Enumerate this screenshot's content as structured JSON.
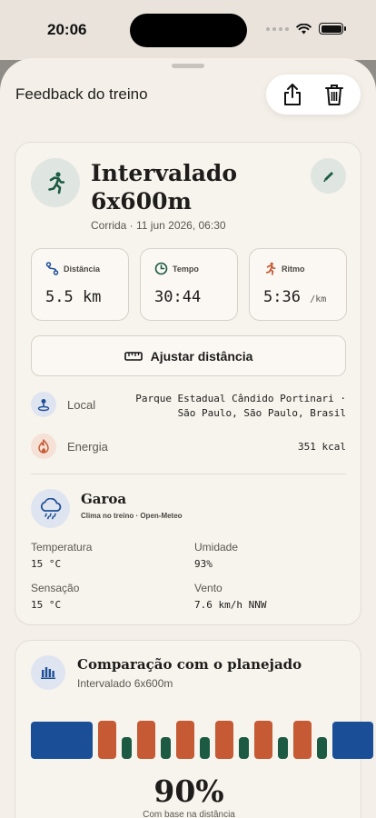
{
  "status": {
    "time": "20:06"
  },
  "sheet": {
    "title": "Feedback do treino"
  },
  "workout": {
    "title": "Intervalado 6x600m",
    "subtitle": "Corrida · 11 jun 2026, 06:30"
  },
  "stats": [
    {
      "label": "Distância",
      "value": "5.5 km",
      "unit": "",
      "icon": "route-icon",
      "color": "#1f4f96"
    },
    {
      "label": "Tempo",
      "value": "30:44",
      "unit": "",
      "icon": "clock-icon",
      "color": "#1c5a44"
    },
    {
      "label": "Ritmo",
      "value": "5:36",
      "unit": "/km",
      "icon": "runner-icon",
      "color": "#c55a34"
    }
  ],
  "adjust_button": {
    "label": "Ajustar distância"
  },
  "location": {
    "label": "Local",
    "value_line1": "Parque Estadual Cândido Portinari ·",
    "value_line2": "São Paulo, São Paulo, Brasil"
  },
  "energy": {
    "label": "Energia",
    "value": "351 kcal"
  },
  "weather": {
    "condition": "Garoa",
    "source": "Clima no treino · Open-Meteo",
    "temperature_label": "Temperatura",
    "temperature": "15 °C",
    "humidity_label": "Umidade",
    "humidity": "93%",
    "feels_label": "Sensação",
    "feels": "15 °C",
    "wind_label": "Vento",
    "wind": "7.6 km/h NNW"
  },
  "comparison": {
    "title": "Comparação com o planejado",
    "subtitle": "Intervalado 6x600m",
    "percent": "90%",
    "note": "Com base na distância",
    "segments": [
      {
        "kind": "warmup",
        "color": "#1a4f98"
      },
      {
        "kind": "interval",
        "color": "#c55a34"
      },
      {
        "kind": "recovery",
        "color": "#1c5a44"
      },
      {
        "kind": "interval",
        "color": "#c55a34"
      },
      {
        "kind": "recovery",
        "color": "#1c5a44"
      },
      {
        "kind": "interval",
        "color": "#c55a34"
      },
      {
        "kind": "recovery",
        "color": "#1c5a44"
      },
      {
        "kind": "interval",
        "color": "#c55a34"
      },
      {
        "kind": "recovery",
        "color": "#1c5a44"
      },
      {
        "kind": "interval",
        "color": "#c55a34"
      },
      {
        "kind": "recovery",
        "color": "#1c5a44"
      },
      {
        "kind": "interval",
        "color": "#c55a34"
      },
      {
        "kind": "recovery",
        "color": "#1c5a44"
      },
      {
        "kind": "cooldown",
        "color": "#1a4f98"
      }
    ]
  },
  "colors": {
    "accent_green": "#1c5a44",
    "accent_blue": "#1a4f98",
    "accent_orange": "#c55a34",
    "background": "#f4efe8"
  }
}
